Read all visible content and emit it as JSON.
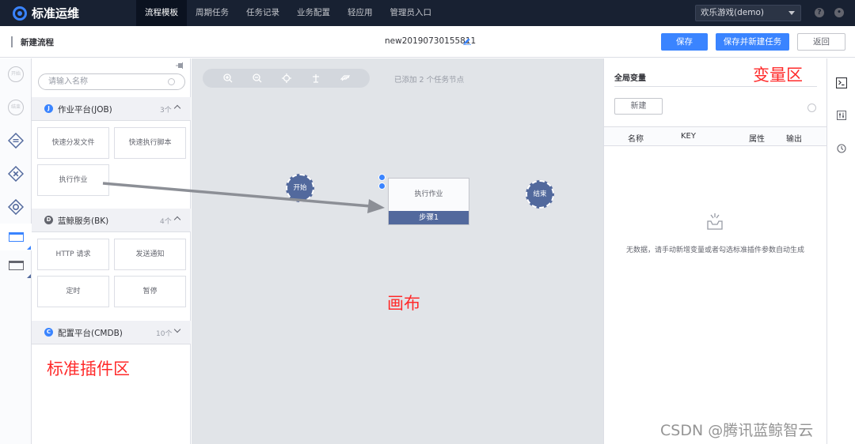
{
  "app": {
    "title": "标准运维",
    "accent": "#3a84ff"
  },
  "nav": {
    "items": [
      {
        "label": "流程模板",
        "active": true
      },
      {
        "label": "周期任务",
        "active": false
      },
      {
        "label": "任务记录",
        "active": false
      },
      {
        "label": "业务配置",
        "active": false
      },
      {
        "label": "轻应用",
        "active": false
      },
      {
        "label": "管理员入口",
        "active": false
      }
    ],
    "project": "欢乐游戏(demo)",
    "help_icon": "question-icon",
    "user_icon": "user-icon"
  },
  "toolbar": {
    "title": "新建流程",
    "flow_name": "new20190730155811",
    "save_label": "保存",
    "save_new_label": "保存并新建任务",
    "back_label": "返回"
  },
  "rail": {
    "start_label": "开始",
    "end_label": "结束"
  },
  "plugins": {
    "search_placeholder": "请输入名称",
    "groups": [
      {
        "badge": "J",
        "name": "作业平台(JOB)",
        "count": "3个",
        "items": [
          "快速分发文件",
          "快速执行脚本",
          "执行作业"
        ]
      },
      {
        "badge": "D",
        "name": "蓝鲸服务(BK)",
        "count": "4个",
        "items": [
          "HTTP 请求",
          "发送通知",
          "定时",
          "暂停"
        ]
      },
      {
        "badge": "C",
        "name": "配置平台(CMDB)",
        "count": "10个",
        "items": []
      }
    ],
    "annotation": "标准插件区"
  },
  "canvas": {
    "status": "已添加 2 个任务节点",
    "start_node": "开始",
    "end_node": "结束",
    "task_name": "执行作业",
    "task_step": "步骤1",
    "annotation": "画布"
  },
  "vars": {
    "title": "全局变量",
    "new_label": "新建",
    "columns": [
      "名称",
      "KEY",
      "属性",
      "输出"
    ],
    "empty_text": "无数据，请手动新增变量或者勾选标准插件参数自动生成",
    "annotation": "变量区"
  },
  "watermark": "CSDN @腾讯蓝鲸智云"
}
